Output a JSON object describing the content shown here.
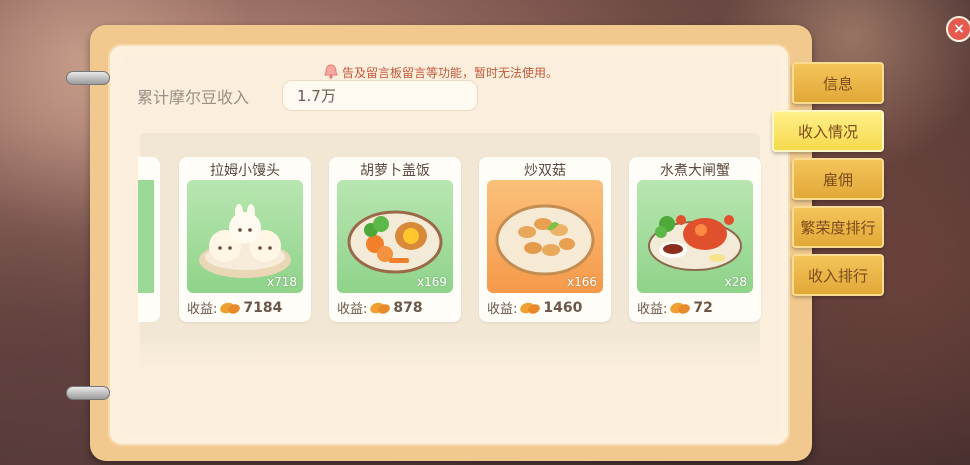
{
  "notice": {
    "text": "告及留言板留言等功能，暂时无法使用。"
  },
  "income": {
    "label": "累计摩尔豆收入",
    "value": "1.7万"
  },
  "cards": [
    {
      "name": "拉姆小馒头",
      "count": "x718",
      "earn_label": "收益:",
      "earn_value": "7184"
    },
    {
      "name": "胡萝卜盖饭",
      "count": "x169",
      "earn_label": "收益:",
      "earn_value": "878"
    },
    {
      "name": "炒双菇",
      "count": "x166",
      "earn_label": "收益:",
      "earn_value": "1460"
    },
    {
      "name": "水煮大闸蟹",
      "count": "x28",
      "earn_label": "收益:",
      "earn_value": "72"
    }
  ],
  "tabs": [
    {
      "label": "信息"
    },
    {
      "label": "收入情况"
    },
    {
      "label": "雇佣"
    },
    {
      "label": "繁荣度排行"
    },
    {
      "label": "收入排行"
    }
  ],
  "close": {
    "label": "×"
  },
  "icons": {
    "notice": "bell-icon",
    "bean": "bean-icon",
    "close": "close-icon"
  },
  "colors": {
    "tab": "#e9b445",
    "tab_active": "#f9e46a",
    "accent_text": "#c25a3a"
  }
}
